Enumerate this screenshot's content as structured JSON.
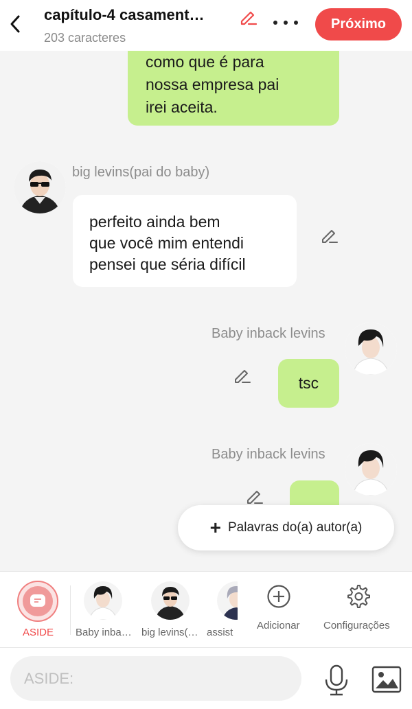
{
  "header": {
    "title": "capítulo-4 casament…",
    "char_count": "203 caracteres",
    "next_label": "Próximo"
  },
  "messages": [
    {
      "side": "right",
      "color": "green",
      "lines": [
        "como que é para",
        "nossa empresa pai",
        "irei aceita."
      ]
    },
    {
      "side": "left",
      "speaker": "big levins(pai do baby)",
      "color": "white",
      "lines": [
        "perfeito ainda bem",
        "que você mim entendi",
        "pensei que séria difícil"
      ]
    },
    {
      "side": "right",
      "speaker": "Baby inback levins",
      "color": "green",
      "text": "tsc"
    },
    {
      "side": "right",
      "speaker": "Baby inback levins",
      "color": "green",
      "text": ""
    }
  ],
  "fab": {
    "label": "Palavras do(a) autor(a)"
  },
  "characters": [
    {
      "label": "ASIDE",
      "selected": true
    },
    {
      "label": "Baby inba…"
    },
    {
      "label": "big levins(…"
    },
    {
      "label": "assist"
    },
    {
      "label": "Adicionar",
      "icon": "plus-circle-icon"
    },
    {
      "label": "Configurações",
      "icon": "gear-icon"
    }
  ],
  "input": {
    "placeholder": "ASIDE:"
  },
  "colors": {
    "accent": "#f04a4a",
    "bubble_green": "#c6ef8e",
    "bubble_white": "#ffffff",
    "background": "#f4f4f4"
  }
}
